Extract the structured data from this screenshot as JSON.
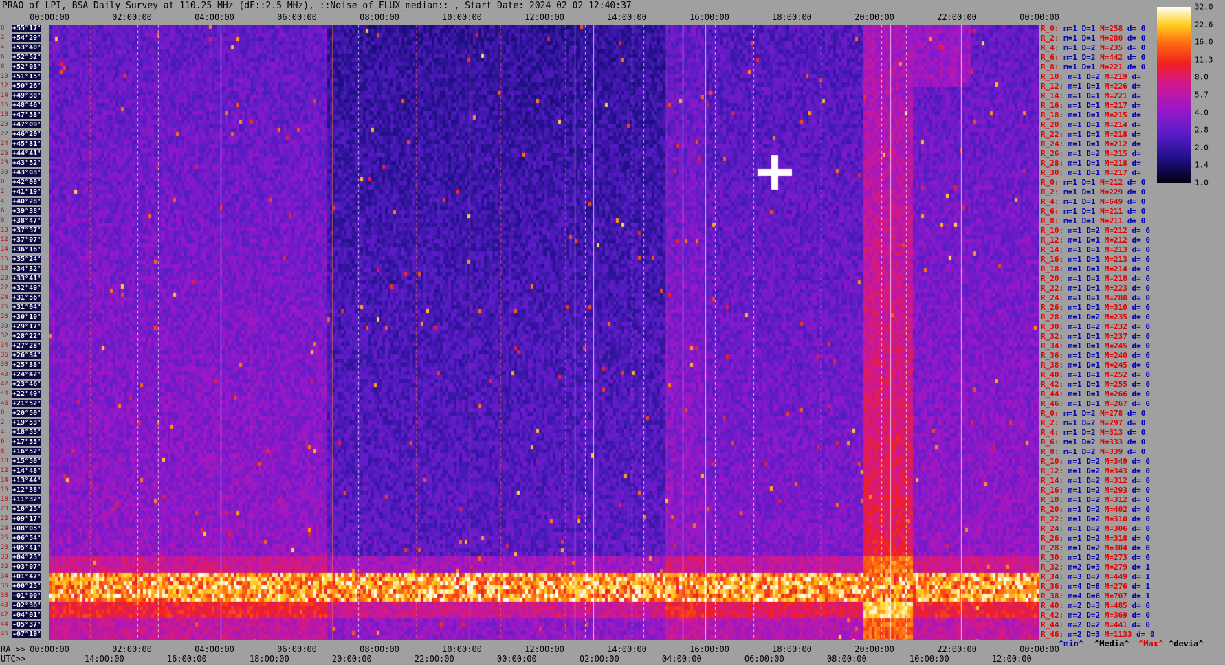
{
  "title": "PRAO of LPI, BSA Daily Survey at 110.25 MHz (dF::2.5 MHz), ::Noise_of_FLUX_median:: , Start Date: 2024 02 02 12:40:37",
  "top_axis_ticks": [
    "00:00:00",
    "02:00:00",
    "04:00:00",
    "06:00:00",
    "08:00:00",
    "10:00:00",
    "12:00:00",
    "14:00:00",
    "16:00:00",
    "18:00:00",
    "20:00:00",
    "22:00:00",
    "00:00:00"
  ],
  "ra_prefix": "RA >>",
  "ra_axis_ticks": [
    "00:00:00",
    "02:00:00",
    "04:00:00",
    "06:00:00",
    "08:00:00",
    "10:00:00",
    "12:00:00",
    "14:00:00",
    "16:00:00",
    "18:00:00",
    "20:00:00",
    "22:00:00",
    "00:00:00"
  ],
  "utc_prefix": "UTC>>",
  "utc_axis_ticks": [
    "14:00:00",
    "16:00:00",
    "18:00:00",
    "20:00:00",
    "22:00:00",
    "00:00:00",
    "02:00:00",
    "04:00:00",
    "06:00:00",
    "08:00:00",
    "10:00:00",
    "12:00:00"
  ],
  "colors": {
    "background": "#a0a0a0",
    "accent_red": "#e00000",
    "accent_blue": "#0000b0"
  },
  "colorbar": {
    "ticks": [
      "32.0",
      "22.6",
      "16.0",
      "11.3",
      "8.0",
      "5.7",
      "4.0",
      "2.8",
      "2.0",
      "1.4",
      "1.0"
    ]
  },
  "legend_footer": [
    "^min^",
    "^Media^",
    "^Max^",
    "^devia^"
  ],
  "chart_data": {
    "type": "heatmap",
    "title": "PRAO of LPI, BSA Daily Survey at 110.25 MHz (dF::2.5 MHz), ::Noise_of_FLUX_median:: , Start Date: 2024 02 02 12:40:37",
    "x_ticks_top": [
      "00:00:00",
      "02:00:00",
      "04:00:00",
      "06:00:00",
      "08:00:00",
      "10:00:00",
      "12:00:00",
      "14:00:00",
      "16:00:00",
      "18:00:00",
      "20:00:00",
      "22:00:00",
      "00:00:00"
    ],
    "colorbar_range": [
      1.0,
      32.0
    ],
    "declinations": [
      "+55°17'",
      "+54°29'",
      "+53°40'",
      "+52°52'",
      "+52°03'",
      "+51°15'",
      "+50°26'",
      "+49°38'",
      "+48°46'",
      "+47°58'",
      "+47°09'",
      "+46°20'",
      "+45°31'",
      "+44°41'",
      "+43°52'",
      "+43°03'",
      "+42°08'",
      "+41°19'",
      "+40°28'",
      "+39°38'",
      "+38°47'",
      "+37°57'",
      "+37°07'",
      "+36°16'",
      "+35°24'",
      "+34°32'",
      "+33°41'",
      "+32°49'",
      "+31°56'",
      "+31°04'",
      "+30°10'",
      "+29°17'",
      "+28°22'",
      "+27°28'",
      "+26°34'",
      "+25°38'",
      "+24°42'",
      "+23°46'",
      "+22°49'",
      "+21°52'",
      "+20°50'",
      "+19°53'",
      "+18°55'",
      "+17°55'",
      "+16°52'",
      "+15°50'",
      "+14°48'",
      "+13°44'",
      "+12°38'",
      "+11°32'",
      "+10°25'",
      "+09°17'",
      "+08°05'",
      "+06°54'",
      "+05°41'",
      "+04°25'",
      "+03°07'",
      "+01°47'",
      "+00°25'",
      "-01°00'",
      "-02°30'",
      "-04°01'",
      "-05°37'",
      "-07°19'"
    ],
    "row_index": [
      "0",
      "2",
      "4",
      "6",
      "8",
      "10",
      "12",
      "14",
      "16",
      "18",
      "20",
      "22",
      "24",
      "26",
      "28",
      "30",
      "0",
      "2",
      "4",
      "6",
      "8",
      "10",
      "12",
      "14",
      "16",
      "18",
      "20",
      "22",
      "24",
      "26",
      "28",
      "30",
      "32",
      "34",
      "36",
      "38",
      "40",
      "42",
      "44",
      "46",
      "0",
      "2",
      "4",
      "6",
      "8",
      "10",
      "12",
      "14",
      "16",
      "18",
      "20",
      "22",
      "24",
      "26",
      "28",
      "30",
      "32",
      "34",
      "36",
      "38",
      "40",
      "42",
      "44",
      "46"
    ],
    "rows": [
      {
        "r": "R_0:",
        "m": "m=1",
        "d": "D=1",
        "mx": "M=258",
        "dv": "d= 0"
      },
      {
        "r": "R_2:",
        "m": "m=1",
        "d": "D=1",
        "mx": "M=280",
        "dv": "d= 0"
      },
      {
        "r": "R_4:",
        "m": "m=1",
        "d": "D=2",
        "mx": "M=235",
        "dv": "d= 0"
      },
      {
        "r": "R_6:",
        "m": "m=1",
        "d": "D=2",
        "mx": "M=442",
        "dv": "d= 0"
      },
      {
        "r": "R_8:",
        "m": "m=1",
        "d": "D=1",
        "mx": "M=221",
        "dv": "d= 0"
      },
      {
        "r": "R_10:",
        "m": "m=1",
        "d": "D=2",
        "mx": "M=219",
        "dv": "d="
      },
      {
        "r": "R_12:",
        "m": "m=1",
        "d": "D=1",
        "mx": "M=226",
        "dv": "d="
      },
      {
        "r": "R_14:",
        "m": "m=1",
        "d": "D=1",
        "mx": "M=221",
        "dv": "d="
      },
      {
        "r": "R_16:",
        "m": "m=1",
        "d": "D=1",
        "mx": "M=217",
        "dv": "d="
      },
      {
        "r": "R_18:",
        "m": "m=1",
        "d": "D=1",
        "mx": "M=215",
        "dv": "d="
      },
      {
        "r": "R_20:",
        "m": "m=1",
        "d": "D=1",
        "mx": "M=214",
        "dv": "d="
      },
      {
        "r": "R_22:",
        "m": "m=1",
        "d": "D=1",
        "mx": "M=218",
        "dv": "d="
      },
      {
        "r": "R_24:",
        "m": "m=1",
        "d": "D=1",
        "mx": "M=212",
        "dv": "d="
      },
      {
        "r": "R_26:",
        "m": "m=1",
        "d": "D=2",
        "mx": "M=215",
        "dv": "d="
      },
      {
        "r": "R_28:",
        "m": "m=1",
        "d": "D=1",
        "mx": "M=218",
        "dv": "d="
      },
      {
        "r": "R_30:",
        "m": "m=1",
        "d": "D=1",
        "mx": "M=217",
        "dv": "d="
      },
      {
        "r": "R_0:",
        "m": "m=1",
        "d": "D=1",
        "mx": "M=212",
        "dv": "d= 0"
      },
      {
        "r": "R_2:",
        "m": "m=1",
        "d": "D=1",
        "mx": "M=229",
        "dv": "d= 0"
      },
      {
        "r": "R_4:",
        "m": "m=1",
        "d": "D=1",
        "mx": "M=649",
        "dv": "d= 0"
      },
      {
        "r": "R_6:",
        "m": "m=1",
        "d": "D=1",
        "mx": "M=211",
        "dv": "d= 0"
      },
      {
        "r": "R_8:",
        "m": "m=1",
        "d": "D=1",
        "mx": "M=211",
        "dv": "d= 0"
      },
      {
        "r": "R_10:",
        "m": "m=1",
        "d": "D=2",
        "mx": "M=212",
        "dv": "d= 0"
      },
      {
        "r": "R_12:",
        "m": "m=1",
        "d": "D=1",
        "mx": "M=212",
        "dv": "d= 0"
      },
      {
        "r": "R_14:",
        "m": "m=1",
        "d": "D=1",
        "mx": "M=213",
        "dv": "d= 0"
      },
      {
        "r": "R_16:",
        "m": "m=1",
        "d": "D=1",
        "mx": "M=213",
        "dv": "d= 0"
      },
      {
        "r": "R_18:",
        "m": "m=1",
        "d": "D=1",
        "mx": "M=214",
        "dv": "d= 0"
      },
      {
        "r": "R_20:",
        "m": "m=1",
        "d": "D=1",
        "mx": "M=218",
        "dv": "d= 0"
      },
      {
        "r": "R_22:",
        "m": "m=1",
        "d": "D=1",
        "mx": "M=223",
        "dv": "d= 0"
      },
      {
        "r": "R_24:",
        "m": "m=1",
        "d": "D=1",
        "mx": "M=280",
        "dv": "d= 0"
      },
      {
        "r": "R_26:",
        "m": "m=1",
        "d": "D=1",
        "mx": "M=310",
        "dv": "d= 0"
      },
      {
        "r": "R_28:",
        "m": "m=1",
        "d": "D=2",
        "mx": "M=235",
        "dv": "d= 0"
      },
      {
        "r": "R_30:",
        "m": "m=1",
        "d": "D=2",
        "mx": "M=232",
        "dv": "d= 0"
      },
      {
        "r": "R_32:",
        "m": "m=1",
        "d": "D=1",
        "mx": "M=237",
        "dv": "d= 0"
      },
      {
        "r": "R_34:",
        "m": "m=1",
        "d": "D=1",
        "mx": "M=245",
        "dv": "d= 0"
      },
      {
        "r": "R_36:",
        "m": "m=1",
        "d": "D=1",
        "mx": "M=240",
        "dv": "d= 0"
      },
      {
        "r": "R_38:",
        "m": "m=1",
        "d": "D=1",
        "mx": "M=245",
        "dv": "d= 0"
      },
      {
        "r": "R_40:",
        "m": "m=1",
        "d": "D=1",
        "mx": "M=252",
        "dv": "d= 0"
      },
      {
        "r": "R_42:",
        "m": "m=1",
        "d": "D=1",
        "mx": "M=255",
        "dv": "d= 0"
      },
      {
        "r": "R_44:",
        "m": "m=1",
        "d": "D=1",
        "mx": "M=266",
        "dv": "d= 0"
      },
      {
        "r": "R_46:",
        "m": "m=1",
        "d": "D=1",
        "mx": "M=267",
        "dv": "d= 0"
      },
      {
        "r": "R_0:",
        "m": "m=1",
        "d": "D=2",
        "mx": "M=278",
        "dv": "d= 0"
      },
      {
        "r": "R_2:",
        "m": "m=1",
        "d": "D=2",
        "mx": "M=297",
        "dv": "d= 0"
      },
      {
        "r": "R_4:",
        "m": "m=1",
        "d": "D=2",
        "mx": "M=313",
        "dv": "d= 0"
      },
      {
        "r": "R_6:",
        "m": "m=1",
        "d": "D=2",
        "mx": "M=333",
        "dv": "d= 0"
      },
      {
        "r": "R_8:",
        "m": "m=1",
        "d": "D=2",
        "mx": "M=339",
        "dv": "d= 0"
      },
      {
        "r": "R_10:",
        "m": "m=1",
        "d": "D=2",
        "mx": "M=349",
        "dv": "d= 0"
      },
      {
        "r": "R_12:",
        "m": "m=1",
        "d": "D=2",
        "mx": "M=343",
        "dv": "d= 0"
      },
      {
        "r": "R_14:",
        "m": "m=1",
        "d": "D=2",
        "mx": "M=312",
        "dv": "d= 0"
      },
      {
        "r": "R_16:",
        "m": "m=1",
        "d": "D=2",
        "mx": "M=293",
        "dv": "d= 0"
      },
      {
        "r": "R_18:",
        "m": "m=1",
        "d": "D=2",
        "mx": "M=312",
        "dv": "d= 0"
      },
      {
        "r": "R_20:",
        "m": "m=1",
        "d": "D=2",
        "mx": "M=402",
        "dv": "d= 0"
      },
      {
        "r": "R_22:",
        "m": "m=1",
        "d": "D=2",
        "mx": "M=310",
        "dv": "d= 0"
      },
      {
        "r": "R_24:",
        "m": "m=1",
        "d": "D=2",
        "mx": "M=306",
        "dv": "d= 0"
      },
      {
        "r": "R_26:",
        "m": "m=1",
        "d": "D=2",
        "mx": "M=318",
        "dv": "d= 0"
      },
      {
        "r": "R_28:",
        "m": "m=1",
        "d": "D=2",
        "mx": "M=304",
        "dv": "d= 0"
      },
      {
        "r": "R_30:",
        "m": "m=1",
        "d": "D=2",
        "mx": "M=273",
        "dv": "d= 0"
      },
      {
        "r": "R_32:",
        "m": "m=2",
        "d": "D=3",
        "mx": "M=279",
        "dv": "d= 1"
      },
      {
        "r": "R_34:",
        "m": "m=3",
        "d": "D=7",
        "mx": "M=449",
        "dv": "d= 1"
      },
      {
        "r": "R_36:",
        "m": "m=4",
        "d": "D=8",
        "mx": "M=276",
        "dv": "d= 1"
      },
      {
        "r": "R_38:",
        "m": "m=4",
        "d": "D=6",
        "mx": "M=707",
        "dv": "d= 1"
      },
      {
        "r": "R_40:",
        "m": "m=2",
        "d": "D=3",
        "mx": "M=485",
        "dv": "d= 0"
      },
      {
        "r": "R_42:",
        "m": "m=2",
        "d": "D=2",
        "mx": "M=369",
        "dv": "d= 0"
      },
      {
        "r": "R_44:",
        "m": "m=2",
        "d": "D=2",
        "mx": "M=441",
        "dv": "d= 0"
      },
      {
        "r": "R_46:",
        "m": "m=2",
        "d": "D=3",
        "mx": "M=1133",
        "dv": "d= 0"
      }
    ]
  }
}
